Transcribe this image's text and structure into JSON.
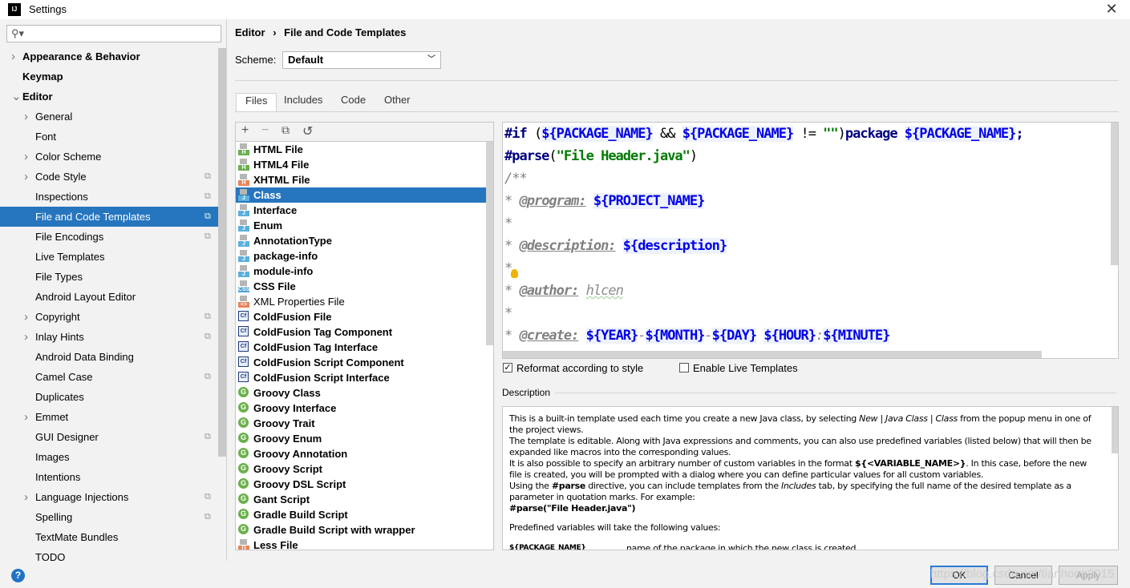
{
  "window": {
    "title": "Settings",
    "app_icon": "IJ",
    "close_icon": "close-icon"
  },
  "search": {
    "placeholder": "",
    "icon": "search-icon"
  },
  "sidebar": {
    "items": [
      {
        "label": "Appearance & Behavior",
        "level": 0,
        "bold": true,
        "arrow": "right"
      },
      {
        "label": "Keymap",
        "level": 0,
        "bold": true
      },
      {
        "label": "Editor",
        "level": 0,
        "bold": true,
        "arrow": "down"
      },
      {
        "label": "General",
        "level": 1,
        "arrow": "right"
      },
      {
        "label": "Font",
        "level": 1
      },
      {
        "label": "Color Scheme",
        "level": 1,
        "arrow": "right"
      },
      {
        "label": "Code Style",
        "level": 1,
        "arrow": "right",
        "project": true
      },
      {
        "label": "Inspections",
        "level": 1,
        "project": true
      },
      {
        "label": "File and Code Templates",
        "level": 1,
        "project": true,
        "selected": true
      },
      {
        "label": "File Encodings",
        "level": 1,
        "project": true
      },
      {
        "label": "Live Templates",
        "level": 1
      },
      {
        "label": "File Types",
        "level": 1
      },
      {
        "label": "Android Layout Editor",
        "level": 1
      },
      {
        "label": "Copyright",
        "level": 1,
        "arrow": "right",
        "project": true
      },
      {
        "label": "Inlay Hints",
        "level": 1,
        "arrow": "right",
        "project": true
      },
      {
        "label": "Android Data Binding",
        "level": 1
      },
      {
        "label": "Camel Case",
        "level": 1,
        "project": true
      },
      {
        "label": "Duplicates",
        "level": 1
      },
      {
        "label": "Emmet",
        "level": 1,
        "arrow": "right"
      },
      {
        "label": "GUI Designer",
        "level": 1,
        "project": true
      },
      {
        "label": "Images",
        "level": 1
      },
      {
        "label": "Intentions",
        "level": 1
      },
      {
        "label": "Language Injections",
        "level": 1,
        "arrow": "right",
        "project": true
      },
      {
        "label": "Spelling",
        "level": 1,
        "project": true
      },
      {
        "label": "TextMate Bundles",
        "level": 1
      },
      {
        "label": "TODO",
        "level": 1
      }
    ]
  },
  "breadcrumb": {
    "parent": "Editor",
    "separator": "›",
    "current": "File and Code Templates"
  },
  "scheme": {
    "label": "Scheme:",
    "value": "Default"
  },
  "tabs": [
    {
      "label": "Files",
      "selected": true
    },
    {
      "label": "Includes"
    },
    {
      "label": "Code"
    },
    {
      "label": "Other"
    }
  ],
  "toolbar": {
    "add": "+",
    "remove": "−",
    "copy": "⧉",
    "reset": "↺"
  },
  "files": [
    {
      "name": "HTML File",
      "icon": "html"
    },
    {
      "name": "HTML4 File",
      "icon": "html"
    },
    {
      "name": "XHTML File",
      "icon": "xhtml"
    },
    {
      "name": "Class",
      "icon": "java",
      "selected": true
    },
    {
      "name": "Interface",
      "icon": "java"
    },
    {
      "name": "Enum",
      "icon": "java"
    },
    {
      "name": "AnnotationType",
      "icon": "java"
    },
    {
      "name": "package-info",
      "icon": "java"
    },
    {
      "name": "module-info",
      "icon": "java"
    },
    {
      "name": "CSS File",
      "icon": "css"
    },
    {
      "name": "XML Properties File",
      "icon": "xml",
      "plain": true
    },
    {
      "name": "ColdFusion File",
      "icon": "cf"
    },
    {
      "name": "ColdFusion Tag Component",
      "icon": "cf"
    },
    {
      "name": "ColdFusion Tag Interface",
      "icon": "cf"
    },
    {
      "name": "ColdFusion Script Component",
      "icon": "cf"
    },
    {
      "name": "ColdFusion Script Interface",
      "icon": "cf"
    },
    {
      "name": "Groovy Class",
      "icon": "groovy"
    },
    {
      "name": "Groovy Interface",
      "icon": "groovy"
    },
    {
      "name": "Groovy Trait",
      "icon": "groovy"
    },
    {
      "name": "Groovy Enum",
      "icon": "groovy"
    },
    {
      "name": "Groovy Annotation",
      "icon": "groovy"
    },
    {
      "name": "Groovy Script",
      "icon": "groovy"
    },
    {
      "name": "Groovy DSL Script",
      "icon": "groovy"
    },
    {
      "name": "Gant Script",
      "icon": "groovy"
    },
    {
      "name": "Gradle Build Script",
      "icon": "groovy"
    },
    {
      "name": "Gradle Build Script with wrapper",
      "icon": "groovy"
    },
    {
      "name": "Less File",
      "icon": "less"
    }
  ],
  "code": [
    [
      [
        "#if",
        "d"
      ],
      [
        " (",
        "p"
      ],
      [
        "${PACKAGE_NAME}",
        "v"
      ],
      [
        " && ",
        "p"
      ],
      [
        "${PACKAGE_NAME}",
        "v"
      ],
      [
        " != ",
        "p"
      ],
      [
        "\"\"",
        "s"
      ],
      [
        ")",
        "p"
      ],
      [
        "package ",
        "d"
      ],
      [
        "${PACKAGE_NAME}",
        "v"
      ],
      [
        ";",
        "d"
      ]
    ],
    [
      [
        "#parse",
        "d"
      ],
      [
        "(",
        "p"
      ],
      [
        "\"File Header.java\"",
        "s"
      ],
      [
        ")",
        "p"
      ]
    ],
    [
      [
        "/**",
        "c"
      ]
    ],
    [
      [
        "* ",
        "c"
      ],
      [
        "@program:",
        "t"
      ],
      [
        " ",
        "p"
      ],
      [
        "${PROJECT_NAME}",
        "v"
      ]
    ],
    [
      [
        "*",
        "c"
      ]
    ],
    [
      [
        "* ",
        "c"
      ],
      [
        "@description:",
        "t"
      ],
      [
        " ",
        "p"
      ],
      [
        "${description}",
        "v"
      ]
    ],
    [
      [
        "*",
        "c"
      ]
    ],
    [
      [
        "* ",
        "c"
      ],
      [
        "@author:",
        "t"
      ],
      [
        " ",
        "p"
      ],
      [
        "hlcen",
        "a"
      ]
    ],
    [
      [
        "*",
        "c"
      ]
    ],
    [
      [
        "* ",
        "c"
      ],
      [
        "@create:",
        "t"
      ],
      [
        " ",
        "p"
      ],
      [
        "${YEAR}",
        "v"
      ],
      [
        "-",
        "c"
      ],
      [
        "${MONTH}",
        "v"
      ],
      [
        "-",
        "c"
      ],
      [
        "${DAY}",
        "v"
      ],
      [
        " ",
        "p"
      ],
      [
        "${HOUR}",
        "v"
      ],
      [
        ":",
        "c"
      ],
      [
        "${MINUTE}",
        "v"
      ]
    ],
    [
      [
        "**/",
        "c"
      ]
    ]
  ],
  "options": {
    "reformat": {
      "label": "Reformat according to style",
      "checked": true
    },
    "live_templates": {
      "label": "Enable Live Templates",
      "checked": false
    }
  },
  "description": {
    "label": "Description",
    "p1": {
      "a": "This is a built-in template used each time you create a new Java class, by selecting ",
      "b": "New | Java Class | Class",
      "c": " from the popup menu in one of the project views."
    },
    "p2": "The template is editable. Along with Java expressions and comments, you can also use predefined variables (listed below) that will then be expanded like macros into the corresponding values.",
    "p3": {
      "a": "It is also possible to specify an arbitrary number of custom variables in the format ",
      "b": "${<VARIABLE_NAME>}",
      "c": ". In this case, before the new file is created, you will be prompted with a dialog where you can define particular values for all custom variables."
    },
    "p4": {
      "a": "Using the ",
      "b": "#parse",
      "c": " directive, you can include templates from the ",
      "d": "Includes",
      "e": " tab, by specifying the full name of the desired template as a parameter in quotation marks. For example:"
    },
    "example": "#parse(\"File Header.java\")",
    "p5": "Predefined variables will take the following values:",
    "var_name": "${PACKAGE_NAME}",
    "var_desc": "name of the package in which the new class is created"
  },
  "buttons": {
    "help": "?",
    "ok": "OK",
    "cancel": "Cancel",
    "apply": "Apply"
  },
  "watermark": "https://blog.csdn.net/tianhong2015",
  "colors": {
    "selection": "#2675bf",
    "variable": "#0000e6",
    "directive": "#000080",
    "string": "#007a00",
    "comment": "#808080"
  }
}
